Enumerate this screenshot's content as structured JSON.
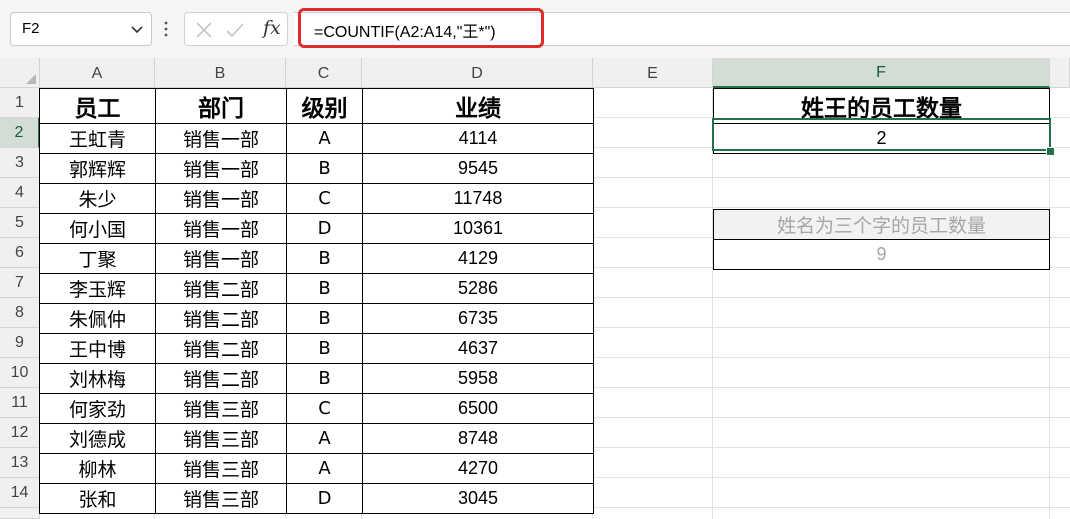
{
  "formula_bar": {
    "name_box": "F2",
    "formula": "=COUNTIF(A2:A14,\"王*\")",
    "fx_label": "fx",
    "icons": [
      "chevron-down-icon",
      "vertical-dots-icon",
      "cancel-x-icon",
      "check-icon",
      "fx-icon"
    ]
  },
  "sheet": {
    "columns": [
      "A",
      "B",
      "C",
      "D",
      "E",
      "F"
    ],
    "rows": [
      "1",
      "2",
      "3",
      "4",
      "5",
      "6",
      "7",
      "8",
      "9",
      "10",
      "11",
      "12",
      "13",
      "14"
    ],
    "selected_column": "F",
    "selected_row": "2",
    "active_cell": "F2"
  },
  "data_table": {
    "headers": [
      "员工",
      "部门",
      "级别",
      "业绩"
    ],
    "rows": [
      [
        "王虹青",
        "销售一部",
        "A",
        "4114"
      ],
      [
        "郭辉辉",
        "销售一部",
        "B",
        "9545"
      ],
      [
        "朱少",
        "销售一部",
        "C",
        "11748"
      ],
      [
        "何小国",
        "销售一部",
        "D",
        "10361"
      ],
      [
        "丁聚",
        "销售一部",
        "B",
        "4129"
      ],
      [
        "李玉辉",
        "销售二部",
        "B",
        "5286"
      ],
      [
        "朱佩仲",
        "销售二部",
        "B",
        "6735"
      ],
      [
        "王中博",
        "销售二部",
        "B",
        "4637"
      ],
      [
        "刘林梅",
        "销售二部",
        "B",
        "5958"
      ],
      [
        "何家劲",
        "销售三部",
        "C",
        "6500"
      ],
      [
        "刘德成",
        "销售三部",
        "A",
        "8748"
      ],
      [
        "柳林",
        "销售三部",
        "A",
        "4270"
      ],
      [
        "张和",
        "销售三部",
        "D",
        "3045"
      ]
    ]
  },
  "summary_wang": {
    "header": "姓王的员工数量",
    "value": "2"
  },
  "summary_three_char": {
    "header": "姓名为三个字的员工数量",
    "value": "9"
  },
  "colors": {
    "accent": "#217346",
    "highlight_border": "#e12b2b",
    "muted_text": "#a6a6a6"
  }
}
